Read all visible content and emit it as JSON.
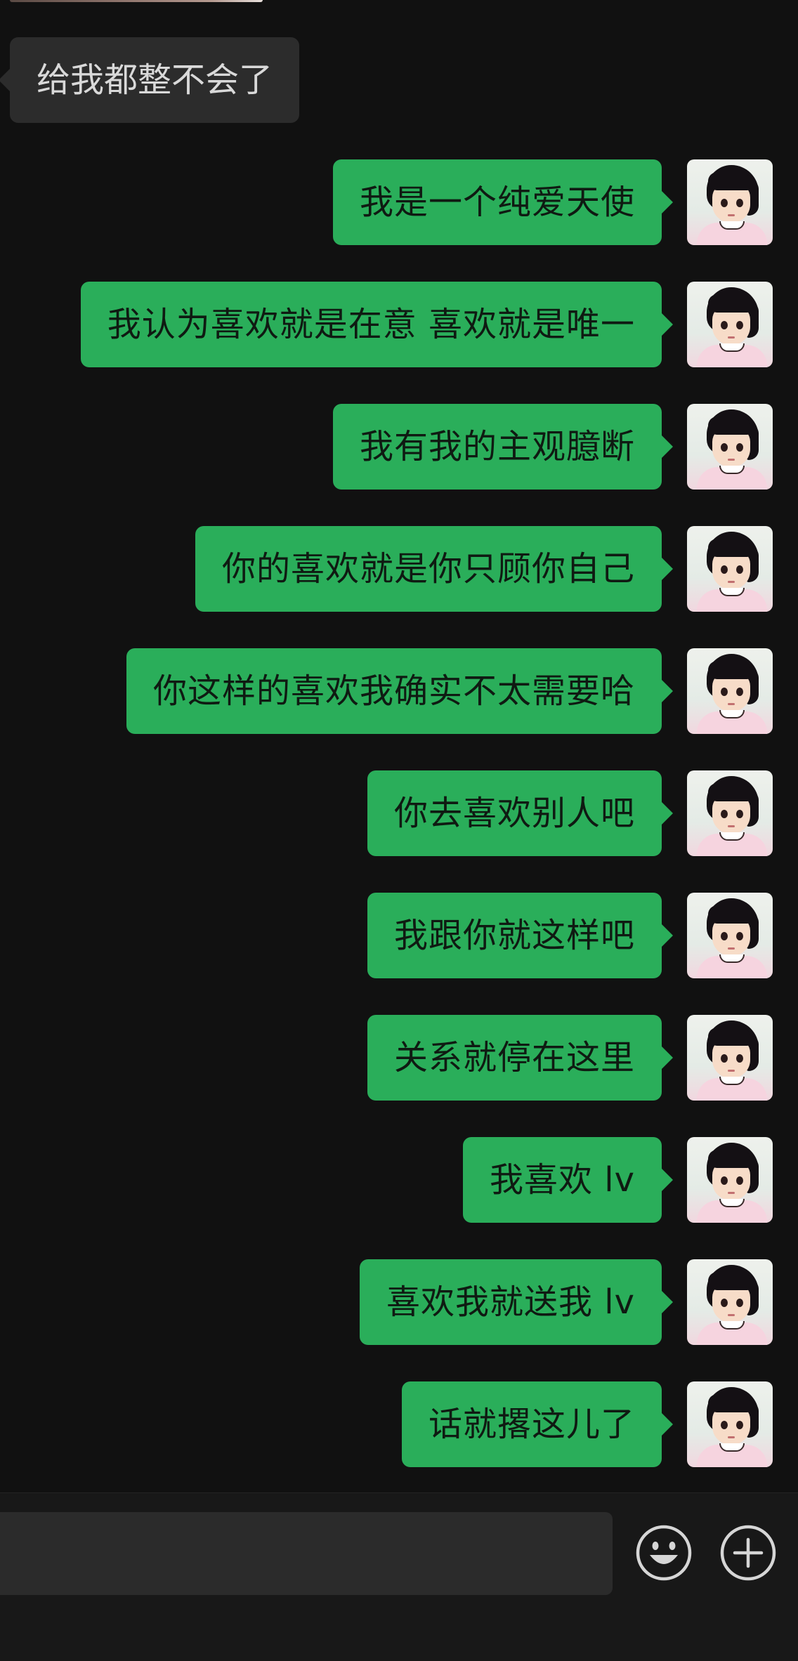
{
  "chat": {
    "messages": [
      {
        "side": "in",
        "text": "给我都整不会了"
      },
      {
        "side": "out",
        "text": "我是一个纯爱天使"
      },
      {
        "side": "out",
        "text": "我认为喜欢就是在意 喜欢就是唯一"
      },
      {
        "side": "out",
        "text": "我有我的主观臆断"
      },
      {
        "side": "out",
        "text": "你的喜欢就是你只顾你自己"
      },
      {
        "side": "out",
        "text": "你这样的喜欢我确实不太需要哈"
      },
      {
        "side": "out",
        "text": "你去喜欢别人吧"
      },
      {
        "side": "out",
        "text": "我跟你就这样吧"
      },
      {
        "side": "out",
        "text": "关系就停在这里"
      },
      {
        "side": "out",
        "text": "我喜欢 lv"
      },
      {
        "side": "out",
        "text": "喜欢我就送我 lv"
      },
      {
        "side": "out",
        "text": "话就撂这儿了"
      }
    ]
  },
  "input_bar": {
    "emoji_icon": "smiley-face-icon",
    "plus_icon": "plus-circle-icon"
  },
  "colors": {
    "background": "#111111",
    "incoming_bubble": "#2c2c2c",
    "outgoing_bubble": "#2aae5a"
  }
}
